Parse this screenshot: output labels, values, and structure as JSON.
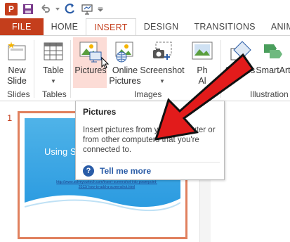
{
  "tabs": [
    {
      "label": "FILE"
    },
    {
      "label": "HOME"
    },
    {
      "label": "INSERT"
    },
    {
      "label": "DESIGN"
    },
    {
      "label": "TRANSITIONS"
    },
    {
      "label": "ANIMA"
    }
  ],
  "ribbon": {
    "new_slide": "New\nSlide",
    "new_slide_l1": "New",
    "new_slide_l2": "Slide",
    "table": "Table",
    "pictures": "Pictures",
    "online_pictures_l1": "Online",
    "online_pictures_l2": "Pictures",
    "screenshot": "Screenshot",
    "photo_album_l1": "Ph",
    "photo_album_l2": "Al",
    "shapes": "Shapes",
    "smartart": "SmartArt",
    "groups": {
      "slides": "Slides",
      "tables": "Tables",
      "images": "Images",
      "illustrations": "Illustration"
    }
  },
  "slide_panel": {
    "slide_number": "1",
    "slide_title": "Using S",
    "slide_link": "http://www.solveyourtech.com/insert-screenshot-into-powerpoint-2013/ how-to-add-a-screenshot.html"
  },
  "tooltip": {
    "title": "Pictures",
    "body": "Insert pictures from your computer or from other computers that you're connected to.",
    "help_label": "Tell me more",
    "help_icon_glyph": "?"
  },
  "colors": {
    "accent": "#c43e1c",
    "arrow": "#e21b1b",
    "slide_blue": "#2a9ae0"
  }
}
